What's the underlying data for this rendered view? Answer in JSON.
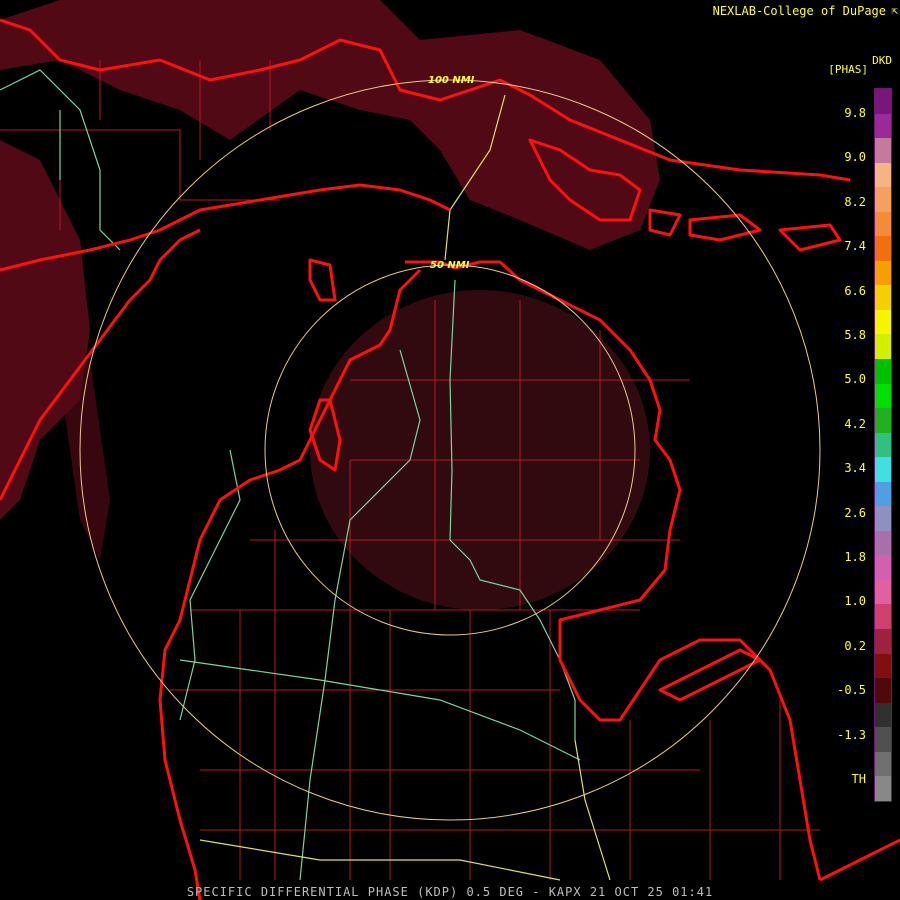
{
  "header": {
    "credit": "NEXLAB-College of DuPage",
    "credit_icon": "external-link-icon"
  },
  "legend": {
    "product_code": "DKD",
    "units": "[PHAS]",
    "ticks": [
      "9.8",
      "9.0",
      "8.2",
      "7.4",
      "6.6",
      "5.8",
      "5.0",
      "4.2",
      "3.4",
      "2.6",
      "1.8",
      "1.0",
      "0.2",
      "-0.5",
      "-1.3",
      "TH"
    ],
    "colors": [
      "#7a167a",
      "#9a2a9a",
      "#c37a9b",
      "#f5b482",
      "#f5a060",
      "#f58a3a",
      "#f07010",
      "#f5a000",
      "#f5d000",
      "#f5f500",
      "#d4ee00",
      "#00c000",
      "#00e000",
      "#20b020",
      "#30c080",
      "#40e0e0",
      "#50a0e0",
      "#9090c0",
      "#a870a8",
      "#d060b0",
      "#e060a0",
      "#d04070",
      "#a02040",
      "#801010",
      "#500808",
      "#303030",
      "#505050",
      "#707070",
      "#888888"
    ]
  },
  "map": {
    "rings": [
      "100 NMI",
      "50 NMI"
    ],
    "colors": {
      "coast": "#ff1010",
      "county": "#cc1a1a",
      "highway_green": "#7cd49e",
      "highway_yellow": "#e0e060",
      "ring": "#e9c98b",
      "echo": "#6e0c1c"
    }
  },
  "footer": {
    "caption": "SPECIFIC DIFFERENTIAL PHASE (KDP) 0.5 DEG - KAPX 21 OCT 25 01:41"
  }
}
